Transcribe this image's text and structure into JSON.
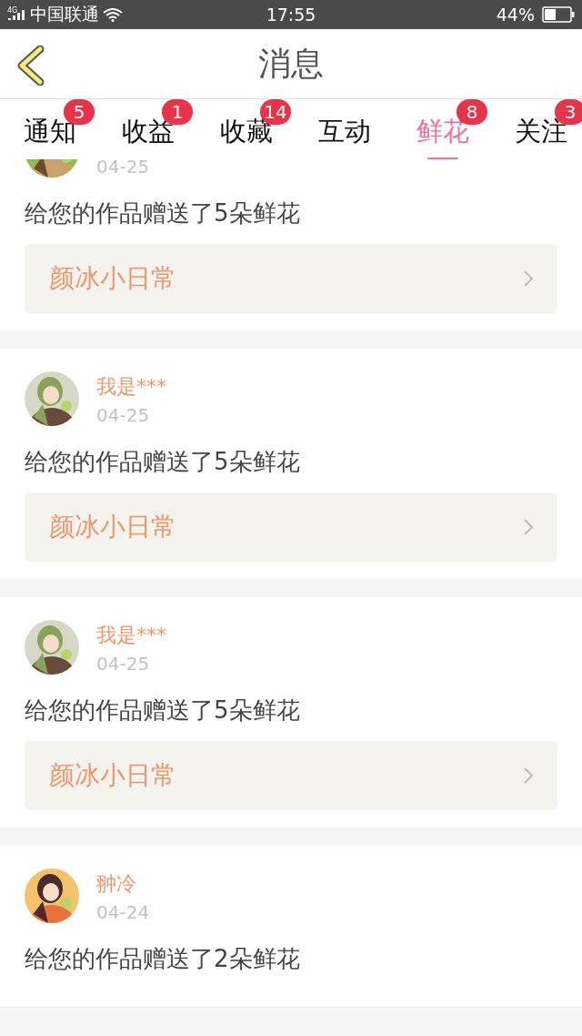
{
  "status_bar": {
    "network": "4G",
    "carrier": "中国联通",
    "time": "17:55",
    "battery": "44%"
  },
  "header": {
    "title": "消息"
  },
  "tabs": [
    {
      "label": "通知",
      "badge": "5",
      "selected": false
    },
    {
      "label": "收益",
      "badge": "1",
      "selected": false
    },
    {
      "label": "收藏",
      "badge": "14",
      "selected": false
    },
    {
      "label": "互动",
      "selected": false
    },
    {
      "label": "鲜花",
      "badge": "8",
      "selected": true
    },
    {
      "label": "关注",
      "badge": "3",
      "selected": false
    }
  ],
  "messages": [
    {
      "date": "04-25",
      "text": "给您的作品赠送了5朵鲜花",
      "link": "颜冰小日常"
    },
    {
      "name": "我是***",
      "date": "04-25",
      "text": "给您的作品赠送了5朵鲜花",
      "link": "颜冰小日常"
    },
    {
      "name": "我是***",
      "date": "04-25",
      "text": "给您的作品赠送了5朵鲜花",
      "link": "颜冰小日常"
    },
    {
      "name": "翀冷",
      "date": "04-24",
      "text": "给您的作品赠送了2朵鲜花"
    }
  ]
}
